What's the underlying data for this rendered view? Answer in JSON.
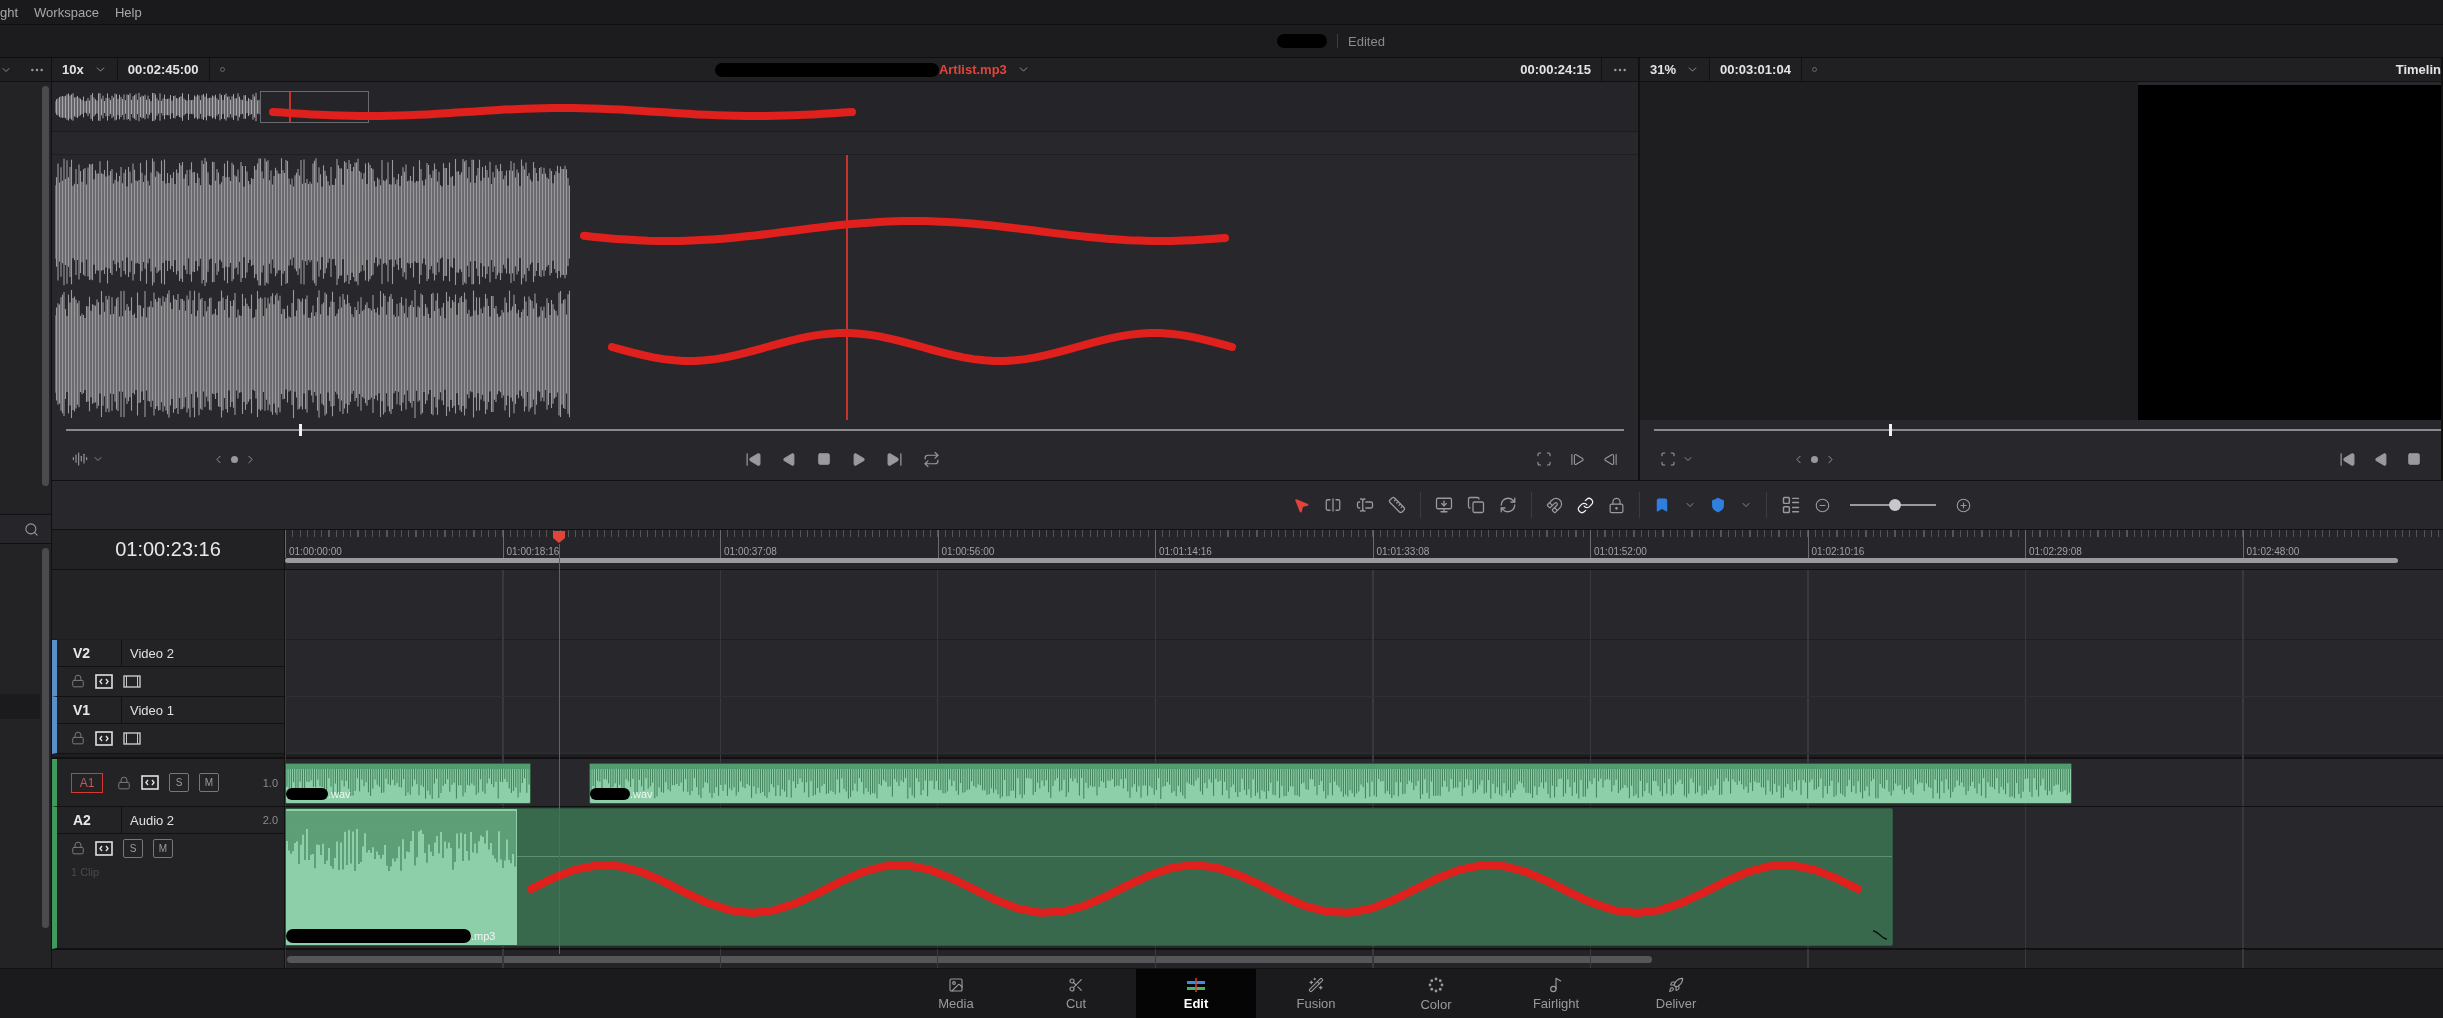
{
  "menu_bar": {
    "items": [
      "ght",
      "Workspace",
      "Help"
    ]
  },
  "title_bar": {
    "status": "Edited"
  },
  "source_viewer": {
    "zoom": "10x",
    "duration": "00:02:45:00",
    "clip_name": "Artlist.mp3",
    "timecode": "00:00:24:15",
    "scrub": {
      "level": 0.15
    }
  },
  "program_viewer": {
    "zoom": "31%",
    "duration": "00:03:01:04",
    "title": "Timelin",
    "scrub": {
      "level": 0.3
    }
  },
  "toolbar": {
    "zoom_slider": {
      "level": 0.52
    }
  },
  "timeline": {
    "timecode": "01:00:23:16",
    "ruler_labels": [
      "01:00:00:00",
      "01:00:18:16",
      "01:00:37:08",
      "01:00:56:00",
      "01:01:14:16",
      "01:01:33:08",
      "01:01:52:00",
      "01:02:10:16",
      "01:02:29:08",
      "01:02:48:00"
    ],
    "tracks": [
      {
        "kind": "video",
        "id": "V2",
        "name": "Video 2"
      },
      {
        "kind": "video",
        "id": "V1",
        "name": "Video 1"
      },
      {
        "kind": "audio",
        "id": "A1",
        "selected": true,
        "volume": "1.0",
        "buttons": [
          "S",
          "M"
        ],
        "clips": [
          {
            "name": ".wav"
          },
          {
            "name": ".wav"
          }
        ]
      },
      {
        "kind": "audio",
        "id": "A2",
        "selected": false,
        "name": "Audio 2",
        "volume": "2.0",
        "buttons": [
          "S",
          "M"
        ],
        "clip_count": "1 Clip",
        "clips": [
          {
            "name": ".mp3"
          }
        ]
      }
    ]
  },
  "page_tabs": [
    {
      "label": "Media",
      "selected": false
    },
    {
      "label": "Cut",
      "selected": false
    },
    {
      "label": "Edit",
      "selected": true
    },
    {
      "label": "Fusion",
      "selected": false
    },
    {
      "label": "Color",
      "selected": false
    },
    {
      "label": "Fairlight",
      "selected": false
    },
    {
      "label": "Deliver",
      "selected": false
    }
  ]
}
